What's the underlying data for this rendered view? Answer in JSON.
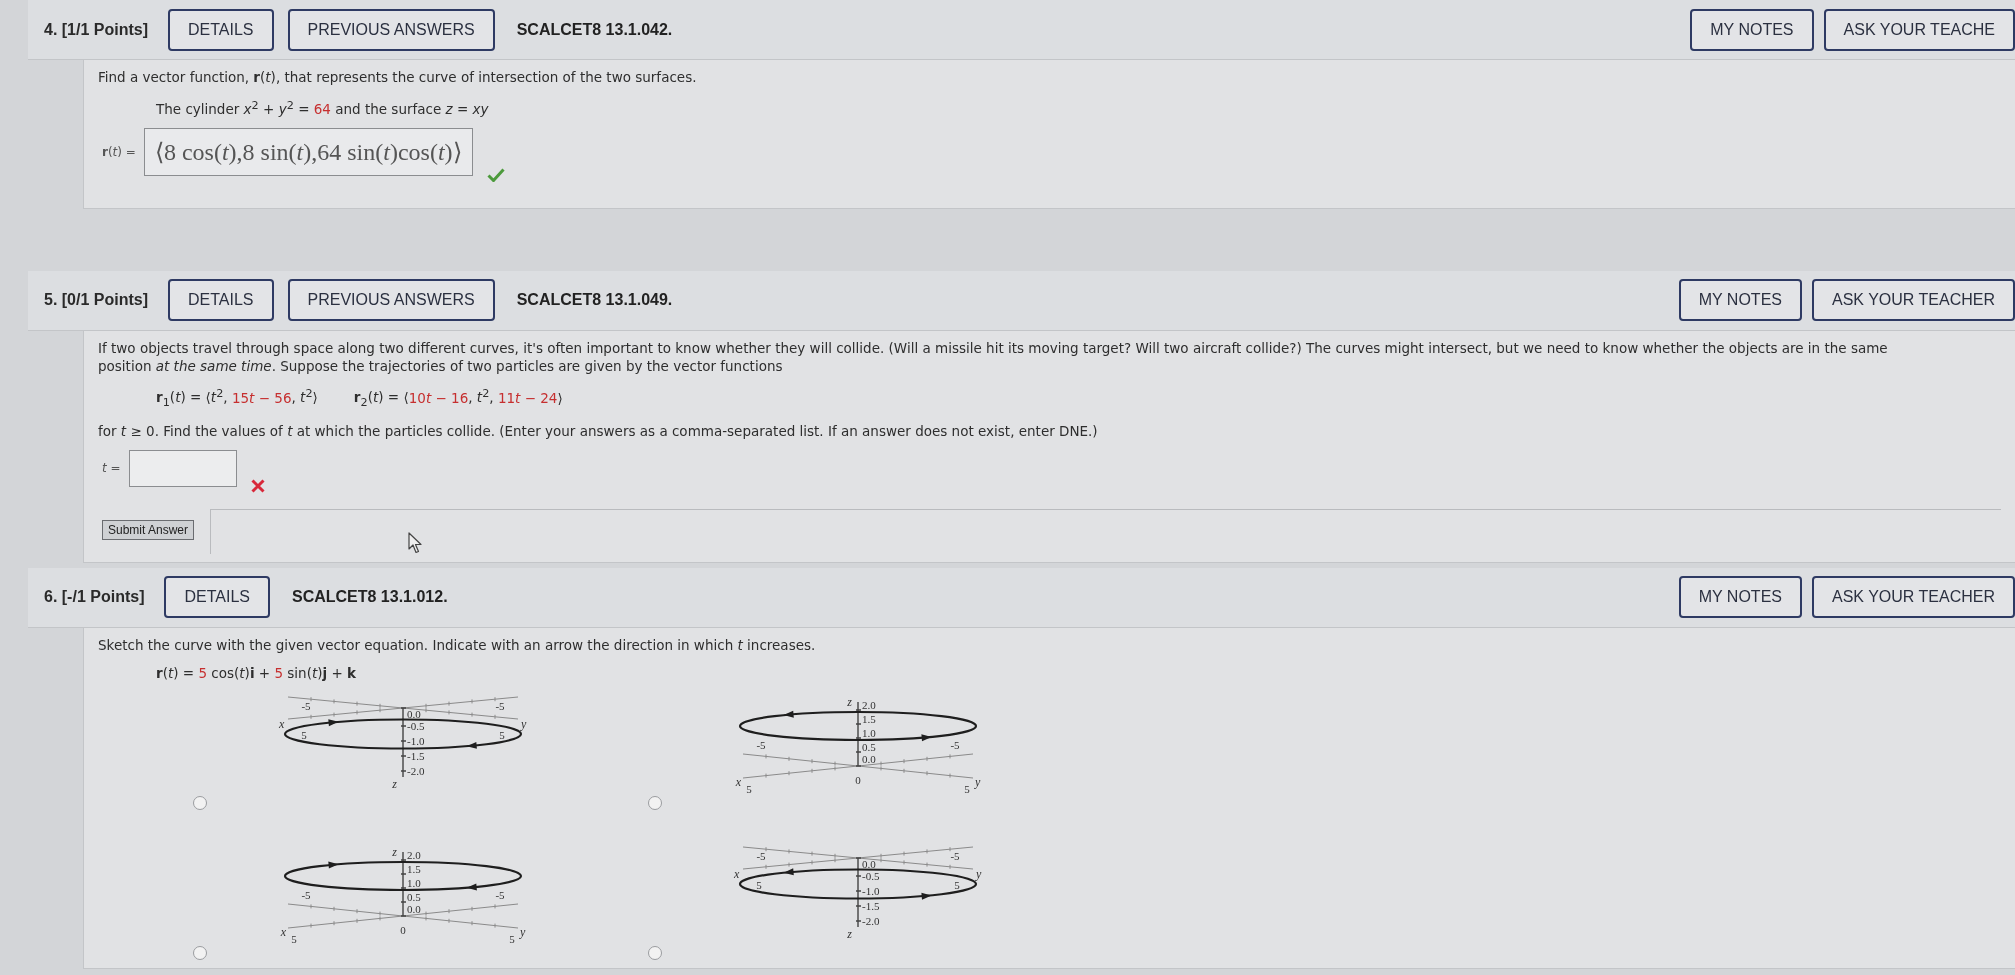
{
  "questions": [
    {
      "title": "4. [1/1 Points]",
      "buttons": [
        "DETAILS",
        "PREVIOUS ANSWERS"
      ],
      "code": "SCALCET8 13.1.042.",
      "side_buttons": [
        "MY NOTES",
        "ASK YOUR TEACHE"
      ],
      "body": [
        {
          "kind": "text",
          "text": "Find a vector function, **r**(*t*), that represents the curve of intersection of the two surfaces."
        },
        {
          "kind": "formula",
          "items": [
            {
              "parts": [
                {
                  "kind": "text",
                  "text": "The cylinder *x*$^{2}$ + *y*$^{2}$ = "
                },
                {
                  "kind": "value",
                  "text": "64"
                },
                {
                  "kind": "text",
                  "text": " and the surface *z* = *xy*"
                }
              ]
            }
          ]
        },
        {
          "kind": "answer",
          "label": "**r**(*t*) =",
          "value": "⟨8 cos(*t*),8 sin(*t*),64 sin(*t*)cos(*t*)⟩",
          "correct": true
        }
      ]
    },
    {
      "title": "5. [0/1 Points]",
      "buttons": [
        "DETAILS",
        "PREVIOUS ANSWERS"
      ],
      "code": "SCALCET8 13.1.049.",
      "side_buttons": [
        "MY NOTES",
        "ASK YOUR TEACHER"
      ],
      "body": [
        {
          "kind": "text",
          "text": "If two objects travel through space along two different curves, it's often important to know whether they will collide. (Will a missile hit its moving target? Will two aircraft collide?) The curves might intersect, but we need to know whether the objects are in the same position *at the same time*. Suppose the trajectories of two particles are given by the vector functions"
        },
        {
          "kind": "formula",
          "items": [
            {
              "parts": [
                {
                  "kind": "text",
                  "text": "**r**$_{1}$(*t*) = ⟨*t*$^{2}$, "
                },
                {
                  "kind": "value",
                  "text": "15"
                },
                {
                  "kind": "value",
                  "text": "*t* − 56"
                },
                {
                  "kind": "text",
                  "text": ", *t*$^{2}$⟩"
                }
              ]
            },
            {
              "parts": [
                {
                  "kind": "text",
                  "text": "**r**$_{2}$(*t*) = ⟨"
                },
                {
                  "kind": "value",
                  "text": "10"
                },
                {
                  "kind": "value",
                  "text": "*t* − 16"
                },
                {
                  "kind": "text",
                  "text": ", *t*$^{2}$, "
                },
                {
                  "kind": "value",
                  "text": "11"
                },
                {
                  "kind": "value",
                  "text": "*t* − 24"
                },
                {
                  "kind": "text",
                  "text": "⟩"
                }
              ]
            }
          ]
        },
        {
          "kind": "text",
          "text": "for *t* ≥ 0. Find the values of *t* at which the particles collide. (Enter your answers as a comma-separated list. If an answer does not exist, enter DNE.)"
        },
        {
          "kind": "answer",
          "label": "*t* =",
          "correct": false
        },
        {
          "kind": "submit",
          "label": "Submit Answer"
        }
      ]
    },
    {
      "title": "6. [-/1 Points]",
      "buttons": [
        "DETAILS"
      ],
      "code": "SCALCET8 13.1.012.",
      "side_buttons": [
        "MY NOTES",
        "ASK YOUR TEACHER"
      ],
      "body": [
        {
          "kind": "text",
          "text": "Sketch the curve with the given vector equation. Indicate with an arrow the direction in which *t* increases."
        },
        {
          "kind": "formula",
          "items": [
            {
              "parts": [
                {
                  "kind": "text",
                  "text": "**r**(*t*) = "
                },
                {
                  "kind": "value",
                  "text": "5"
                },
                {
                  "kind": "text",
                  "text": " cos(*t*)**i** + "
                },
                {
                  "kind": "value",
                  "text": "5"
                },
                {
                  "kind": "text",
                  "text": " sin(*t*)**j** + **k**"
                }
              ]
            }
          ]
        },
        {
          "kind": "choices",
          "options": [
            {
              "selected": false,
              "graph": {
                "z_axis_up": false,
                "clockwise": true,
                "z_label": "z",
                "z_ticks": [
                  "0.0",
                  "-0.5",
                  "-1.0",
                  "-1.5",
                  "-2.0"
                ],
                "x_label": "x",
                "x_ticks": [
                  "5",
                  "-5"
                ],
                "y_label": "y",
                "y_ticks": [
                  "5",
                  "-5"
                ]
              }
            },
            {
              "selected": false,
              "graph": {
                "z_axis_up": true,
                "clockwise": false,
                "z_label": "z",
                "z_ticks": [
                  "2.0",
                  "1.5",
                  "1.0",
                  "0.5",
                  "0.0"
                ],
                "origin": "0",
                "x_label": "x",
                "x_ticks": [
                  "5",
                  "-5"
                ],
                "y_label": "y",
                "y_ticks": [
                  "5",
                  "-5"
                ]
              }
            },
            {
              "selected": false,
              "graph": {
                "z_axis_up": true,
                "clockwise": true,
                "z_label": "z",
                "z_ticks": [
                  "2.0",
                  "1.5",
                  "1.0",
                  "0.5",
                  "0.0"
                ],
                "origin": "0",
                "x_label": "x",
                "x_ticks": [
                  "5",
                  "-5"
                ],
                "y_label": "y",
                "y_ticks": [
                  "5",
                  "-5"
                ]
              }
            },
            {
              "selected": false,
              "graph": {
                "z_axis_up": false,
                "clockwise": false,
                "z_label": "z",
                "z_ticks": [
                  "0.0",
                  "-0.5",
                  "-1.0",
                  "-1.5",
                  "-2.0"
                ],
                "x_label": "x",
                "x_ticks": [
                  "5",
                  "-5"
                ],
                "y_label": "y",
                "y_ticks": [
                  "5",
                  "-5"
                ]
              }
            }
          ]
        }
      ]
    }
  ]
}
